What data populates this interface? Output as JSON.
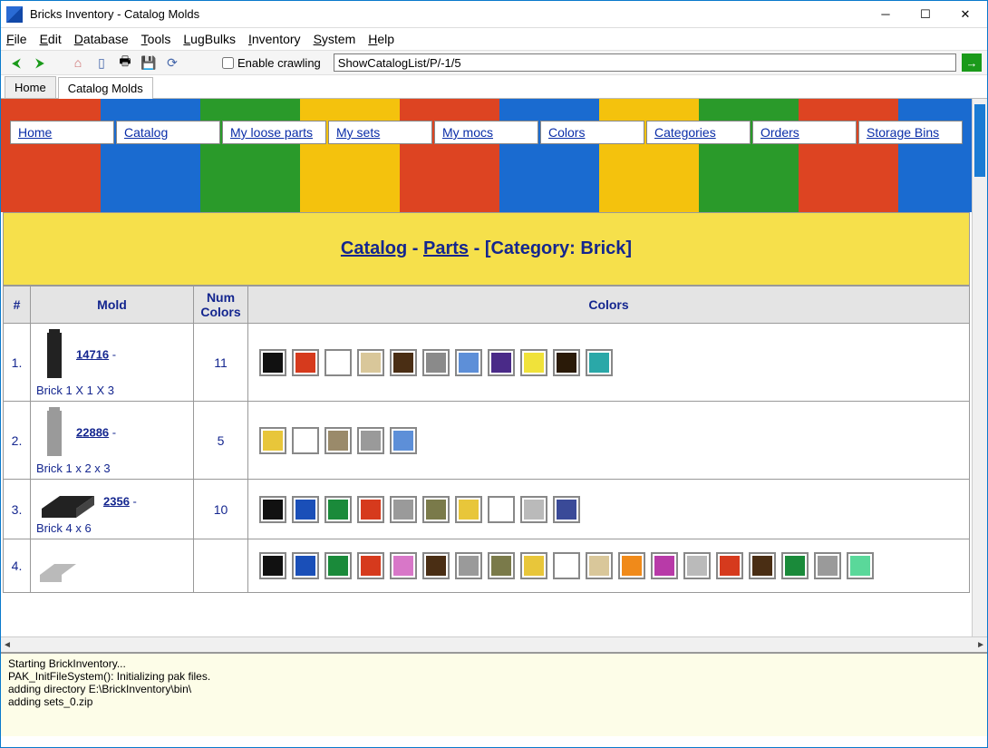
{
  "title": "Bricks Inventory - Catalog Molds",
  "menu": [
    "File",
    "Edit",
    "Database",
    "Tools",
    "LugBulks",
    "Inventory",
    "System",
    "Help"
  ],
  "toolbar": {
    "crawl_label": "Enable crawling",
    "address": "ShowCatalogList/P/-1/5"
  },
  "tabs": [
    "Home",
    "Catalog Molds"
  ],
  "nav": [
    "Home",
    "Catalog",
    "My loose parts",
    "My sets",
    "My mocs",
    "Colors",
    "Categories",
    "Orders",
    "Storage Bins"
  ],
  "breadcrumb": {
    "catalog": "Catalog",
    "parts": "Parts",
    "category_label": "[Category: Brick]"
  },
  "headers": {
    "num": "#",
    "mold": "Mold",
    "numcolors": "Num Colors",
    "colors": "Colors"
  },
  "rows": [
    {
      "n": "1.",
      "id": "14716",
      "desc": "Brick 1 X 1 X 3",
      "count": "11",
      "thumb": {
        "type": "tall-brick",
        "color": "#222"
      },
      "colors": [
        "#111",
        "#d63a1d",
        "#fff",
        "#d9c79a",
        "#4a2e14",
        "#8a8a8a",
        "#5d8fd8",
        "#4a2a88",
        "#f0e23a",
        "#2a1a08",
        "#2aa8a8"
      ]
    },
    {
      "n": "2.",
      "id": "22886",
      "desc": "Brick 1 x 2 x 3",
      "count": "5",
      "thumb": {
        "type": "tall-brick",
        "color": "#9a9a9a"
      },
      "colors": [
        "#e8c63a",
        "#fff",
        "#9a8a6a",
        "#9a9a9a",
        "#5d8fd8"
      ]
    },
    {
      "n": "3.",
      "id": "2356",
      "desc": "Brick 4 x 6",
      "count": "10",
      "thumb": {
        "type": "flat-brick",
        "color": "#222"
      },
      "colors": [
        "#111",
        "#1a4fb8",
        "#1a8a3a",
        "#d63a1d",
        "#9a9a9a",
        "#7a7a4a",
        "#e8c63a",
        "#fff",
        "#bababa",
        "#3a4a98"
      ]
    },
    {
      "n": "4.",
      "id": "",
      "desc": "",
      "count": "",
      "thumb": {
        "type": "angle-brick",
        "color": "#bababa"
      },
      "colors": [
        "#111",
        "#1a4fb8",
        "#1a8a3a",
        "#d63a1d",
        "#d877c8",
        "#4a2e14",
        "#9a9a9a",
        "#7a7a4a",
        "#e8c63a",
        "#fff",
        "#d9c79a",
        "#f08a1a",
        "#b83aa8",
        "#bababa",
        "#d63a1d",
        "#4a2e14",
        "#1a8a3a",
        "#9a9a9a",
        "#5ad89a"
      ]
    }
  ],
  "log": "Starting BrickInventory...\nPAK_InitFileSystem(): Initializing pak files.\nadding directory E:\\BrickInventory\\bin\\\nadding sets_0.zip"
}
